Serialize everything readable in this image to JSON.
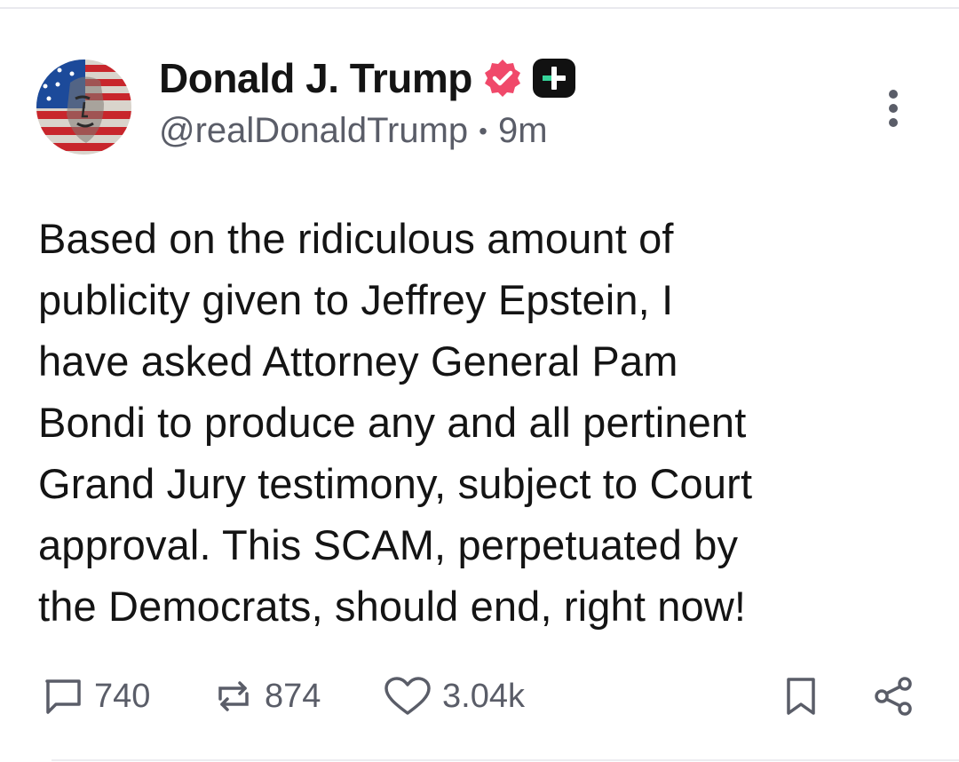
{
  "post": {
    "author": {
      "display_name": "Donald J. Trump",
      "handle": "@realDonaldTrump",
      "separator": "•",
      "time_ago": "9m"
    },
    "text": "Based on the ridiculous amount of\npublicity given to Jeffrey Epstein, I\nhave asked Attorney General Pam\nBondi to produce any and all pertinent\nGrand Jury testimony, subject to Court\napproval. This SCAM, perpetuated by\nthe Democrats, should end, right now!",
    "stats": {
      "replies": "740",
      "reposts": "874",
      "likes": "3.04k"
    }
  },
  "colors": {
    "verified_badge": "#f0496a",
    "plus_badge_bg": "#111111",
    "plus_badge_cross": "#36d399",
    "icon_gray": "#5a5d68"
  },
  "icons": [
    "verified-badge-icon",
    "plus-badge-icon",
    "more-vertical-icon",
    "reply-icon",
    "repost-icon",
    "like-icon",
    "bookmark-icon",
    "share-icon"
  ]
}
